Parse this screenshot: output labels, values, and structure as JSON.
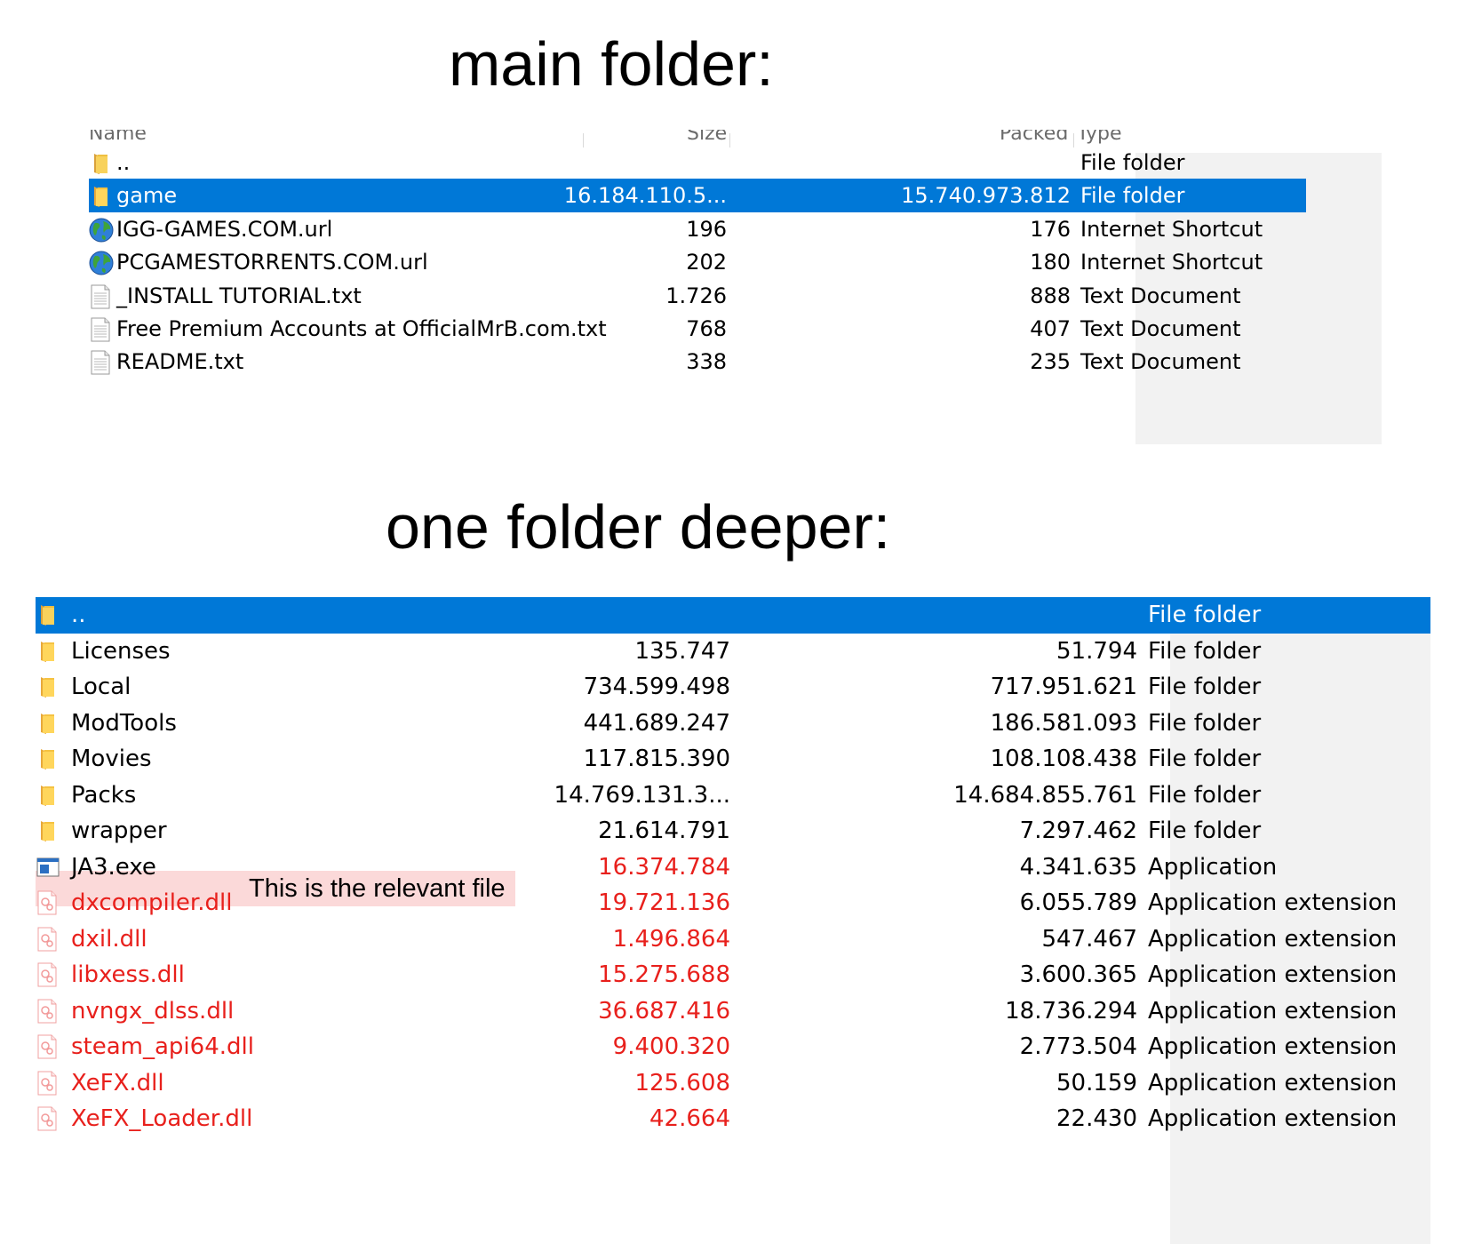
{
  "headings": {
    "main": "main folder:",
    "deeper": "one folder deeper:"
  },
  "columns": {
    "name": "Name",
    "size": "Size",
    "packed": "Packed",
    "type": "Type"
  },
  "colors": {
    "selection": "#0078d7",
    "warning_text": "#e8201c",
    "highlight": "#fbd9d9",
    "type_column_bg": "#f2f2f2"
  },
  "main_folder": [
    {
      "icon": "folder-up-icon",
      "name": "..",
      "size": "",
      "packed": "",
      "type": "File folder"
    },
    {
      "icon": "folder-icon",
      "name": "game",
      "size": "16.184.110.5...",
      "packed": "15.740.973.812",
      "type": "File folder",
      "selected": true
    },
    {
      "icon": "globe-icon",
      "name": "IGG-GAMES.COM.url",
      "size": "196",
      "packed": "176",
      "type": "Internet Shortcut"
    },
    {
      "icon": "globe-icon",
      "name": "PCGAMESTORRENTS.COM.url",
      "size": "202",
      "packed": "180",
      "type": "Internet Shortcut"
    },
    {
      "icon": "text-file-icon",
      "name": "_INSTALL TUTORIAL.txt",
      "size": "1.726",
      "packed": "888",
      "type": "Text Document"
    },
    {
      "icon": "text-file-icon",
      "name": "Free Premium Accounts at OfficialMrB.com.txt",
      "size": "768",
      "packed": "407",
      "type": "Text Document"
    },
    {
      "icon": "text-file-icon",
      "name": "README.txt",
      "size": "338",
      "packed": "235",
      "type": "Text Document"
    }
  ],
  "deeper_folder": [
    {
      "icon": "folder-up-icon",
      "name": "..",
      "size": "",
      "packed": "",
      "type": "File folder",
      "selected": true
    },
    {
      "icon": "folder-icon",
      "name": "Licenses",
      "size": "135.747",
      "packed": "51.794",
      "type": "File folder"
    },
    {
      "icon": "folder-icon",
      "name": "Local",
      "size": "734.599.498",
      "packed": "717.951.621",
      "type": "File folder"
    },
    {
      "icon": "folder-icon",
      "name": "ModTools",
      "size": "441.689.247",
      "packed": "186.581.093",
      "type": "File folder"
    },
    {
      "icon": "folder-icon",
      "name": "Movies",
      "size": "117.815.390",
      "packed": "108.108.438",
      "type": "File folder"
    },
    {
      "icon": "folder-icon",
      "name": "Packs",
      "size": "14.769.131.3...",
      "packed": "14.684.855.761",
      "type": "File folder"
    },
    {
      "icon": "folder-icon",
      "name": "wrapper",
      "size": "21.614.791",
      "packed": "7.297.462",
      "type": "File folder"
    },
    {
      "icon": "exe-icon",
      "name": "JA3.exe",
      "size": "16.374.784",
      "packed": "4.341.635",
      "type": "Application",
      "red_size": true,
      "highlighted": true
    },
    {
      "icon": "dll-icon",
      "name": "dxcompiler.dll",
      "size": "19.721.136",
      "packed": "6.055.789",
      "type": "Application extension",
      "red": true
    },
    {
      "icon": "dll-icon",
      "name": "dxil.dll",
      "size": "1.496.864",
      "packed": "547.467",
      "type": "Application extension",
      "red": true
    },
    {
      "icon": "dll-icon",
      "name": "libxess.dll",
      "size": "15.275.688",
      "packed": "3.600.365",
      "type": "Application extension",
      "red": true
    },
    {
      "icon": "dll-icon",
      "name": "nvngx_dlss.dll",
      "size": "36.687.416",
      "packed": "18.736.294",
      "type": "Application extension",
      "red": true
    },
    {
      "icon": "dll-icon",
      "name": "steam_api64.dll",
      "size": "9.400.320",
      "packed": "2.773.504",
      "type": "Application extension",
      "red": true
    },
    {
      "icon": "dll-icon",
      "name": "XeFX.dll",
      "size": "125.608",
      "packed": "50.159",
      "type": "Application extension",
      "red": true
    },
    {
      "icon": "dll-icon",
      "name": "XeFX_Loader.dll",
      "size": "42.664",
      "packed": "22.430",
      "type": "Application extension",
      "red": true
    }
  ],
  "annotation": "This is the relevant file"
}
